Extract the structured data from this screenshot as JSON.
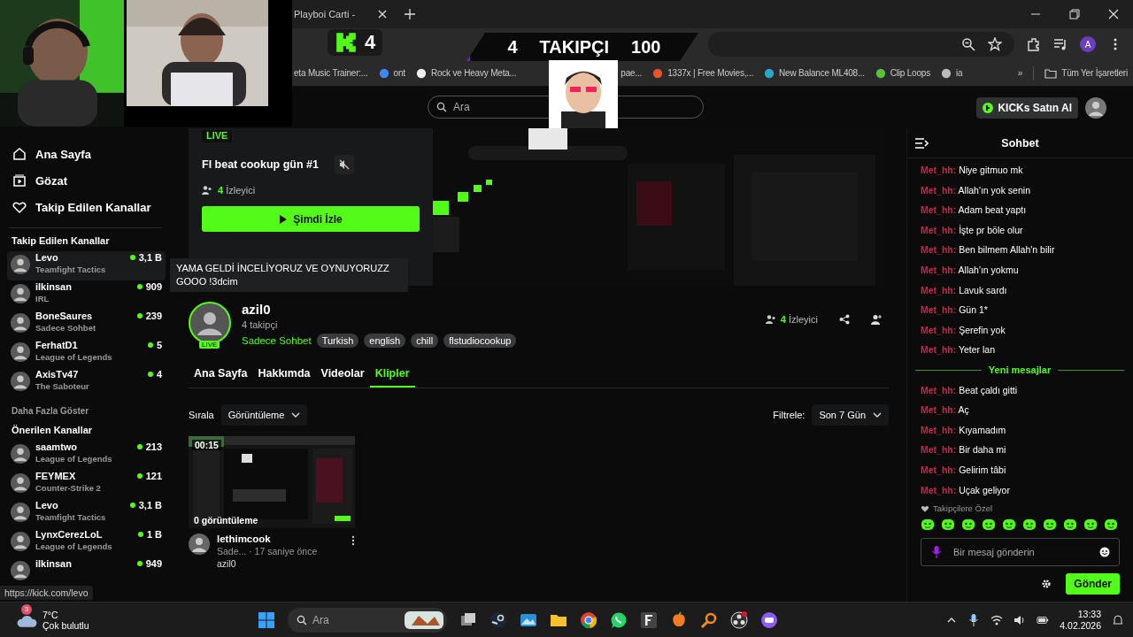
{
  "browser": {
    "tab_title": "Playboi Carti -",
    "profile": "A",
    "bookmarks": [
      {
        "label": "eta Music Trainer:..."
      },
      {
        "label": "ont"
      },
      {
        "label": "Rock ve Heavy Meta..."
      },
      {
        "label": "pae..."
      },
      {
        "label": "1337x | Free Movies,..."
      },
      {
        "label": "New Balance ML408..."
      },
      {
        "label": "Clip Loops"
      },
      {
        "label": "ia"
      }
    ],
    "more": "»",
    "all_bookmarks": "Tüm Yer İşaretleri"
  },
  "overlay": {
    "kick_count": "4",
    "followers": "4",
    "followers_label": "TAKIPÇI",
    "goal": "100"
  },
  "header": {
    "search_placeholder": "Ara",
    "buy_button": "KICKs Satın Al"
  },
  "sidebar": {
    "nav": [
      {
        "label": "Ana Sayfa",
        "kind": "home"
      },
      {
        "label": "Gözat",
        "kind": "browse"
      },
      {
        "label": "Takip Edilen Kanallar",
        "kind": "heart"
      }
    ],
    "followed_title": "Takip Edilen Kanallar",
    "followed": [
      {
        "name": "Levo",
        "category": "Teamfight Tactics",
        "viewers": "3,1 B",
        "hovered": true
      },
      {
        "name": "ilkinsan",
        "category": "IRL",
        "viewers": "909",
        "hovered": false
      },
      {
        "name": "BoneSaures",
        "category": "Sadece Sohbet",
        "viewers": "239",
        "hovered": false
      },
      {
        "name": "FerhatD1",
        "category": "League of Legends",
        "viewers": "5",
        "hovered": false
      },
      {
        "name": "AxisTv47",
        "category": "The Saboteur",
        "viewers": "4",
        "hovered": false
      }
    ],
    "show_more": "Daha Fazla Göster",
    "recommended_title": "Önerilen Kanallar",
    "recommended": [
      {
        "name": "saamtwo",
        "category": "League of Legends",
        "viewers": "213",
        "hovered": false
      },
      {
        "name": "FEYMEX",
        "category": "Counter-Strike 2",
        "viewers": "121",
        "hovered": false
      },
      {
        "name": "Levo",
        "category": "Teamfight Tactics",
        "viewers": "3,1 B",
        "hovered": false
      },
      {
        "name": "LynxCerezLoL",
        "category": "League of Legends",
        "viewers": "1 B",
        "hovered": false
      },
      {
        "name": "ilkinsan",
        "viewers": "949",
        "hovered": false
      }
    ]
  },
  "hero": {
    "badge": "LIVE",
    "title": "Fl beat cookup gün #1",
    "muted": true,
    "viewers": "4",
    "viewers_label": "İzleyici",
    "watch_button": "Şimdi İzle"
  },
  "tooltip": "YAMA GELDİ İNCELİYORUZ VE OYNUYORUZZ GOOO !3dcim",
  "channel": {
    "name": "azil0",
    "followers": "4 takipçi",
    "live_badge": "LIVE",
    "category": "Sadece Sohbet",
    "tags": [
      "Turkish",
      "english",
      "chill",
      "flstudiocookup"
    ],
    "viewers": "4",
    "viewers_label": "İzleyici"
  },
  "tabs": [
    {
      "label": "Ana Sayfa",
      "selected": false
    },
    {
      "label": "Hakkımda",
      "selected": false
    },
    {
      "label": "Videolar",
      "selected": false
    },
    {
      "label": "Klipler",
      "selected": true
    }
  ],
  "clips": {
    "sort_label": "Sırala",
    "sort_value": "Görüntüleme",
    "filter_label": "Filtrele:",
    "filter_value": "Son 7 Gün",
    "items": [
      {
        "duration": "00:15",
        "views": "0 görüntüleme",
        "title": "lethimcook",
        "category": "Sade...",
        "age": "· 17 saniye önce",
        "channel": "azil0"
      }
    ]
  },
  "chat": {
    "title": "Sohbet",
    "messages": [
      {
        "kind": "message",
        "user": "Met_hh:",
        "text": "Niye gitmuo mk"
      },
      {
        "kind": "message",
        "user": "Met_hh:",
        "text": "Allah'ın yok senin"
      },
      {
        "kind": "message",
        "user": "Met_hh:",
        "text": "Adam beat yaptı"
      },
      {
        "kind": "message",
        "user": "Met_hh:",
        "text": "İşte pr böle olur"
      },
      {
        "kind": "message",
        "user": "Met_hh:",
        "text": "Ben bilmem Allah'n bilir"
      },
      {
        "kind": "message",
        "user": "Met_hh:",
        "text": "Allah'ın yokmu"
      },
      {
        "kind": "message",
        "user": "Met_hh:",
        "text": "Lavuk sardı"
      },
      {
        "kind": "message",
        "user": "Met_hh:",
        "text": "Gün 1*"
      },
      {
        "kind": "message",
        "user": "Met_hh:",
        "text": "Şerefin yok"
      },
      {
        "kind": "message",
        "user": "Met_hh:",
        "text": "Yeter lan"
      },
      {
        "kind": "divider",
        "text": "Yeni mesajlar"
      },
      {
        "kind": "message",
        "user": "Met_hh:",
        "text": "Beat çaldı gitti"
      },
      {
        "kind": "message",
        "user": "Met_hh:",
        "text": "Aç"
      },
      {
        "kind": "message",
        "user": "Met_hh:",
        "text": "Kıyamadım"
      },
      {
        "kind": "message",
        "user": "Met_hh:",
        "text": "Bir daha mi"
      },
      {
        "kind": "message",
        "user": "Met_hh:",
        "text": "Gelirim tâbi"
      },
      {
        "kind": "message",
        "user": "Met_hh:",
        "text": "Uçak geliyor"
      }
    ],
    "followers_only": "Takipçilere Özel",
    "input_placeholder": "Bir mesaj gönderin",
    "send_button": "Gönder"
  },
  "status_url": "https://kick.com/levo",
  "taskbar": {
    "weather_badge": "3",
    "temperature": "7°C",
    "weather": "Çok bulutlu",
    "search_placeholder": "Ara",
    "time": "13:33",
    "date": "4.02.2026"
  }
}
